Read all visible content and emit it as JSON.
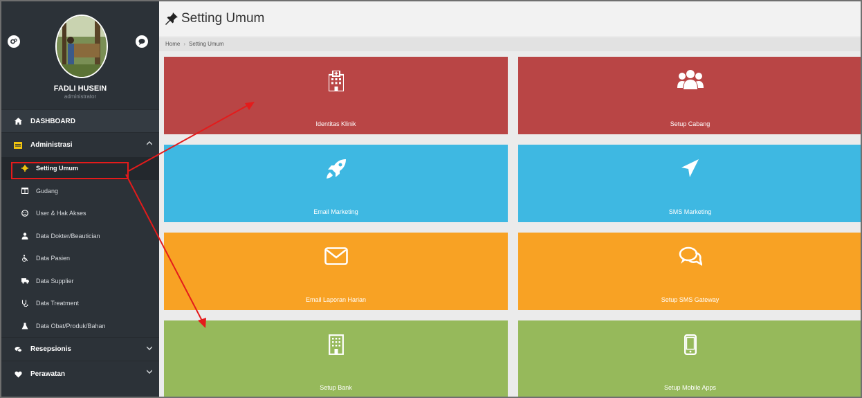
{
  "app": {
    "colors": {
      "sidebar": "#2c3238",
      "red": "#b94545",
      "blue": "#3eb8e2",
      "orange": "#f8a224",
      "green": "#96b95b",
      "annotation": "#e41b1b"
    }
  },
  "profile": {
    "name": "FADLI HUSEIN",
    "role": "administrator"
  },
  "menu": {
    "dashboard": "DASHBOARD",
    "administrasi": "Administrasi",
    "sub": [
      {
        "label": "Setting Umum",
        "icon": "gear-icon"
      },
      {
        "label": "Gudang",
        "icon": "columns-icon"
      },
      {
        "label": "User & Hak Akses",
        "icon": "user-circle-icon"
      },
      {
        "label": "Data Dokter/Beautician",
        "icon": "doctor-icon"
      },
      {
        "label": "Data Pasien",
        "icon": "wheelchair-icon"
      },
      {
        "label": "Data Supplier",
        "icon": "truck-icon"
      },
      {
        "label": "Data Treatment",
        "icon": "stethoscope-icon"
      },
      {
        "label": "Data Obat/Produk/Bahan",
        "icon": "flask-icon"
      }
    ],
    "resepsionis": "Resepsionis",
    "perawatan": "Perawatan"
  },
  "page": {
    "title": "Setting Umum",
    "breadcrumb": {
      "home": "Home",
      "current": "Setting Umum"
    }
  },
  "tiles": [
    {
      "label": "Identitas Klinik",
      "icon": "hospital-icon"
    },
    {
      "label": "Setup Cabang",
      "icon": "users-icon"
    },
    {
      "label": "Email Marketing",
      "icon": "rocket-icon"
    },
    {
      "label": "SMS Marketing",
      "icon": "location-arrow-icon"
    },
    {
      "label": "Email Laporan Harian",
      "icon": "envelope-icon"
    },
    {
      "label": "Setup SMS Gateway",
      "icon": "chat-bubbles-icon"
    },
    {
      "label": "Setup Bank",
      "icon": "building-icon"
    },
    {
      "label": "Setup Mobile Apps",
      "icon": "mobile-phone-icon"
    }
  ]
}
